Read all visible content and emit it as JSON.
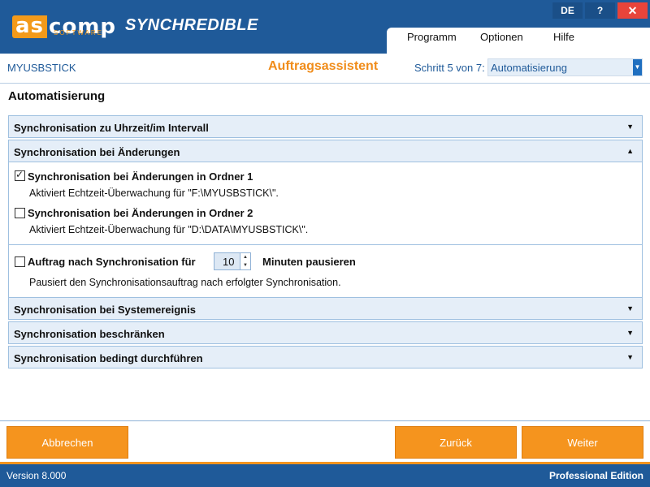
{
  "header": {
    "logo_main": "as",
    "logo_comp": "comp",
    "logo_sub": "SOFTWARE",
    "app_name": "SYNCHREDIBLE",
    "lang_button": "DE",
    "help_button": "?",
    "close_button": "✕"
  },
  "menu": {
    "items": [
      "Programm",
      "Optionen",
      "Hilfe"
    ]
  },
  "wizard": {
    "job_name": "MYUSBSTICK",
    "title": "Auftragsassistent",
    "step_label": "Schritt 5 von 7:",
    "step_value": "Automatisierung"
  },
  "page": {
    "title": "Automatisierung"
  },
  "panels": {
    "p1": "Synchronisation zu Uhrzeit/im Intervall",
    "p2": "Synchronisation bei Änderungen",
    "p3": "Synchronisation bei Systemereignis",
    "p4": "Synchronisation beschränken",
    "p5": "Synchronisation bedingt durchführen"
  },
  "options": {
    "folder1": {
      "checked": true,
      "label": "Synchronisation bei Änderungen in Ordner 1",
      "desc": "Aktiviert Echtzeit-Überwachung für \"F:\\MYUSBSTICK\\\"."
    },
    "folder2": {
      "checked": false,
      "label": "Synchronisation bei Änderungen in Ordner 2",
      "desc": "Aktiviert Echtzeit-Überwachung für \"D:\\DATA\\MYUSBSTICK\\\"."
    },
    "pause": {
      "checked": false,
      "label_before": "Auftrag nach Synchronisation für",
      "value": "10",
      "label_after": "Minuten pausieren",
      "desc": "Pausiert den Synchronisationsauftrag nach erfolgter Synchronisation."
    }
  },
  "buttons": {
    "cancel": "Abbrechen",
    "back": "Zurück",
    "next": "Weiter"
  },
  "status": {
    "version": "Version 8.000",
    "edition": "Professional Edition"
  },
  "colors": {
    "brand_blue": "#1f5a99",
    "accent_orange": "#f5941e",
    "close_red": "#e8443a"
  },
  "icons": {
    "expand": "▼",
    "collapse": "▲",
    "check": "✓"
  }
}
